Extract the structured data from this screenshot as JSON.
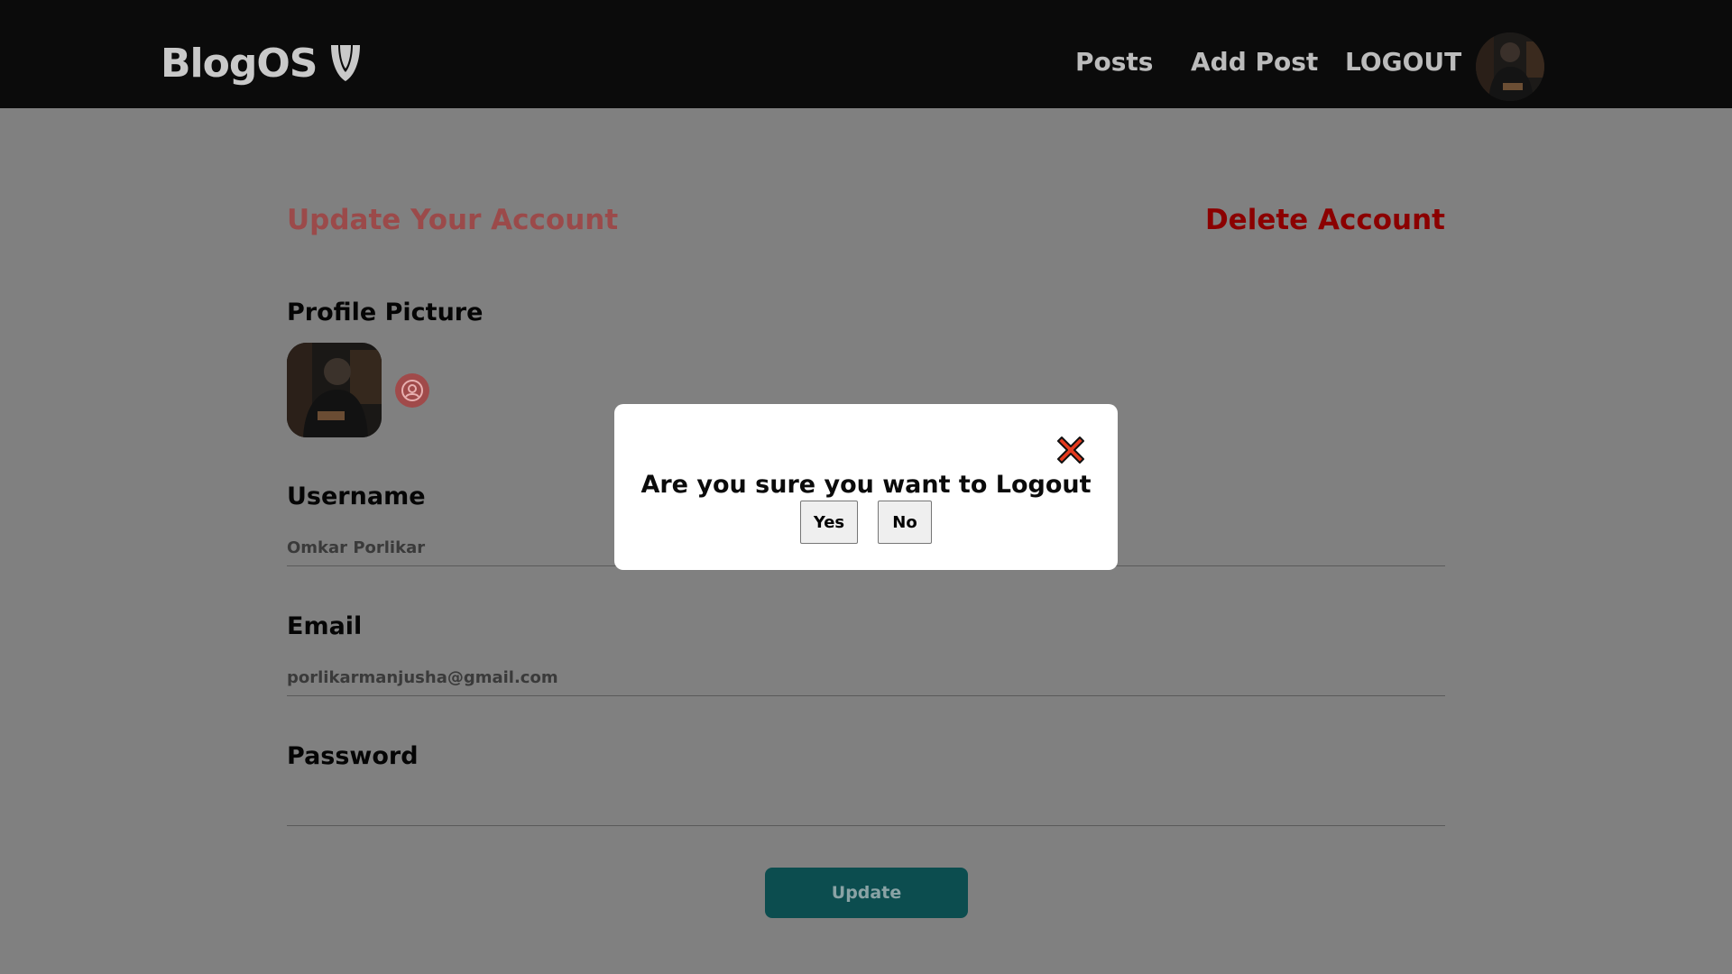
{
  "header": {
    "brand": "BlogOS",
    "brand_icon": "typo3-shield-icon",
    "nav": {
      "posts": "Posts",
      "add_post": "Add Post",
      "logout": "LOGOUT"
    }
  },
  "main": {
    "update_title": "Update Your Account",
    "delete_link": "Delete Account",
    "profile_picture_label": "Profile Picture",
    "username_label": "Username",
    "username_value": "Omkar Porlikar",
    "email_label": "Email",
    "email_value": "porlikarmanjusha@gmail.com",
    "password_label": "Password",
    "password_value": "",
    "update_button": "Update"
  },
  "modal": {
    "message": "Are you sure you want to Logout",
    "yes": "Yes",
    "no": "No",
    "close_icon": "close-x-icon"
  },
  "colors": {
    "header_bg": "#0b0b0b",
    "overlay_bg": "#808080",
    "delete": "#8b0000",
    "update_title": "#9b4a4a",
    "update_button_bg": "#0c4d4f",
    "close_icon_fill": "#e53a1e"
  }
}
